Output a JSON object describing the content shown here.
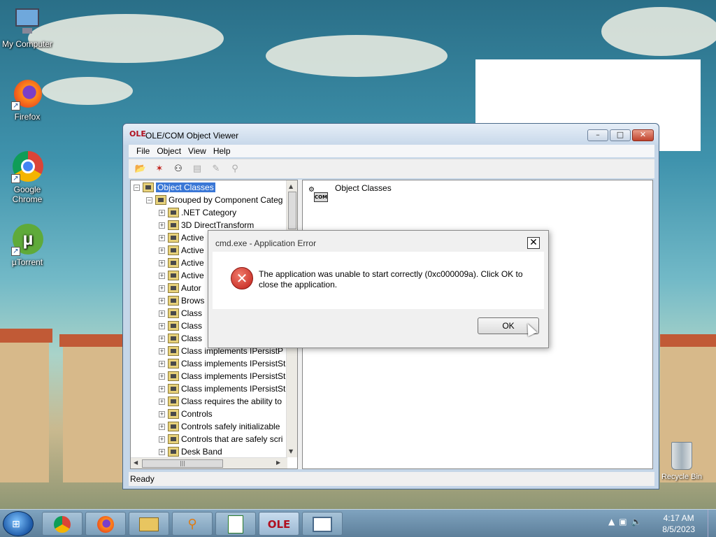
{
  "desktop": {
    "icons": [
      {
        "label": "My Computer",
        "glyph": "computer-icon"
      },
      {
        "label": "Firefox",
        "glyph": "firefox-icon"
      },
      {
        "label": "Google Chrome",
        "glyph": "chrome-icon"
      },
      {
        "label": "µTorrent",
        "glyph": "utorrent-icon"
      }
    ],
    "recycle_bin": "Recycle Bin"
  },
  "window": {
    "title": "OLE/COM Object Viewer",
    "app_icon_text": "OLE",
    "controls": {
      "minimize": "–",
      "maximize": "□",
      "close": "✕"
    },
    "menus": [
      "File",
      "Object",
      "View",
      "Help"
    ],
    "tree": {
      "root": "Object Classes",
      "child": "Grouped by Component Categ",
      "items": [
        ".NET Category",
        "3D DirectTransform",
        "Active",
        "Active",
        "Active",
        "Active",
        "Autor",
        "Brows",
        "Class",
        "Class",
        "Class",
        "Class implements IPersistP",
        "Class implements IPersistSt",
        "Class implements IPersistSt",
        "Class implements IPersistSt",
        "Class requires the ability to",
        "Controls",
        "Controls safely initializable",
        "Controls that are safely scri",
        "Desk Band"
      ]
    },
    "right_pane_title": "Object Classes",
    "com_label": "COM",
    "status": "Ready"
  },
  "dialog": {
    "title": "cmd.exe - Application Error",
    "message": "The application was unable to start correctly (0xc000009a). Click OK to close the application.",
    "ok_label": "OK",
    "close_glyph": "✕"
  },
  "taskbar": {
    "apps": [
      "chrome-icon",
      "firefox-icon",
      "explorer-icon",
      "search-icon",
      "notepad-icon",
      "olecom-icon",
      "window-icon"
    ],
    "time": "4:17 AM",
    "date": "8/5/2023"
  }
}
